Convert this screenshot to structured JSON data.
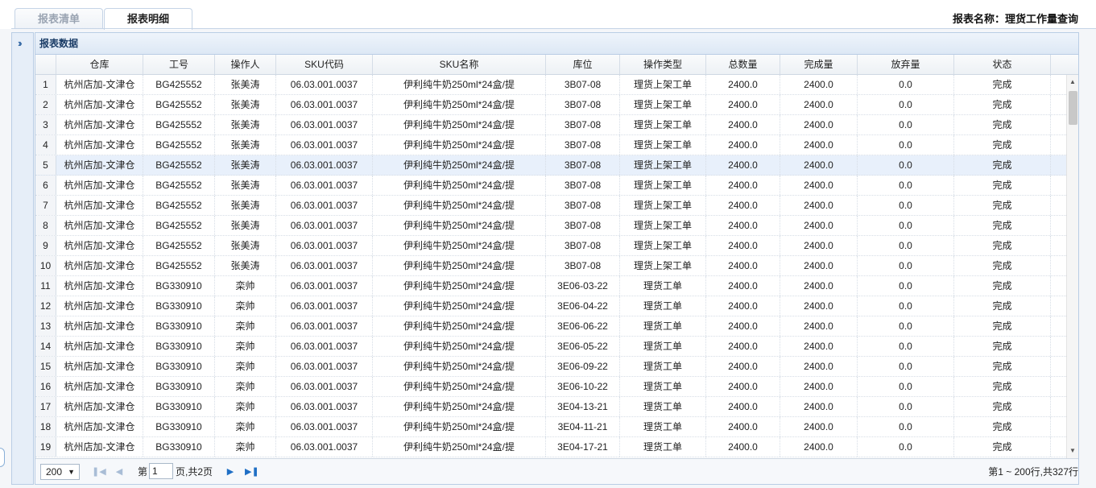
{
  "tabs": [
    {
      "label": "报表清单"
    },
    {
      "label": "报表明细"
    }
  ],
  "report_title": "报表名称：理货工作量查询",
  "panel": {
    "title": "报表数据"
  },
  "columns": [
    "",
    "仓库",
    "工号",
    "操作人",
    "SKU代码",
    "SKU名称",
    "库位",
    "操作类型",
    "总数量",
    "完成量",
    "放弃量",
    "状态"
  ],
  "rows": [
    [
      "1",
      "杭州店加-文津仓",
      "BG425552",
      "张美涛",
      "06.03.001.0037",
      "伊利纯牛奶250ml*24盒/提",
      "3B07-08",
      "理货上架工单",
      "2400.0",
      "2400.0",
      "0.0",
      "完成"
    ],
    [
      "2",
      "杭州店加-文津仓",
      "BG425552",
      "张美涛",
      "06.03.001.0037",
      "伊利纯牛奶250ml*24盒/提",
      "3B07-08",
      "理货上架工单",
      "2400.0",
      "2400.0",
      "0.0",
      "完成"
    ],
    [
      "3",
      "杭州店加-文津仓",
      "BG425552",
      "张美涛",
      "06.03.001.0037",
      "伊利纯牛奶250ml*24盒/提",
      "3B07-08",
      "理货上架工单",
      "2400.0",
      "2400.0",
      "0.0",
      "完成"
    ],
    [
      "4",
      "杭州店加-文津仓",
      "BG425552",
      "张美涛",
      "06.03.001.0037",
      "伊利纯牛奶250ml*24盒/提",
      "3B07-08",
      "理货上架工单",
      "2400.0",
      "2400.0",
      "0.0",
      "完成"
    ],
    [
      "5",
      "杭州店加-文津仓",
      "BG425552",
      "张美涛",
      "06.03.001.0037",
      "伊利纯牛奶250ml*24盒/提",
      "3B07-08",
      "理货上架工单",
      "2400.0",
      "2400.0",
      "0.0",
      "完成"
    ],
    [
      "6",
      "杭州店加-文津仓",
      "BG425552",
      "张美涛",
      "06.03.001.0037",
      "伊利纯牛奶250ml*24盒/提",
      "3B07-08",
      "理货上架工单",
      "2400.0",
      "2400.0",
      "0.0",
      "完成"
    ],
    [
      "7",
      "杭州店加-文津仓",
      "BG425552",
      "张美涛",
      "06.03.001.0037",
      "伊利纯牛奶250ml*24盒/提",
      "3B07-08",
      "理货上架工单",
      "2400.0",
      "2400.0",
      "0.0",
      "完成"
    ],
    [
      "8",
      "杭州店加-文津仓",
      "BG425552",
      "张美涛",
      "06.03.001.0037",
      "伊利纯牛奶250ml*24盒/提",
      "3B07-08",
      "理货上架工单",
      "2400.0",
      "2400.0",
      "0.0",
      "完成"
    ],
    [
      "9",
      "杭州店加-文津仓",
      "BG425552",
      "张美涛",
      "06.03.001.0037",
      "伊利纯牛奶250ml*24盒/提",
      "3B07-08",
      "理货上架工单",
      "2400.0",
      "2400.0",
      "0.0",
      "完成"
    ],
    [
      "10",
      "杭州店加-文津仓",
      "BG425552",
      "张美涛",
      "06.03.001.0037",
      "伊利纯牛奶250ml*24盒/提",
      "3B07-08",
      "理货上架工单",
      "2400.0",
      "2400.0",
      "0.0",
      "完成"
    ],
    [
      "11",
      "杭州店加-文津仓",
      "BG330910",
      "栾帅",
      "06.03.001.0037",
      "伊利纯牛奶250ml*24盒/提",
      "3E06-03-22",
      "理货工单",
      "2400.0",
      "2400.0",
      "0.0",
      "完成"
    ],
    [
      "12",
      "杭州店加-文津仓",
      "BG330910",
      "栾帅",
      "06.03.001.0037",
      "伊利纯牛奶250ml*24盒/提",
      "3E06-04-22",
      "理货工单",
      "2400.0",
      "2400.0",
      "0.0",
      "完成"
    ],
    [
      "13",
      "杭州店加-文津仓",
      "BG330910",
      "栾帅",
      "06.03.001.0037",
      "伊利纯牛奶250ml*24盒/提",
      "3E06-06-22",
      "理货工单",
      "2400.0",
      "2400.0",
      "0.0",
      "完成"
    ],
    [
      "14",
      "杭州店加-文津仓",
      "BG330910",
      "栾帅",
      "06.03.001.0037",
      "伊利纯牛奶250ml*24盒/提",
      "3E06-05-22",
      "理货工单",
      "2400.0",
      "2400.0",
      "0.0",
      "完成"
    ],
    [
      "15",
      "杭州店加-文津仓",
      "BG330910",
      "栾帅",
      "06.03.001.0037",
      "伊利纯牛奶250ml*24盒/提",
      "3E06-09-22",
      "理货工单",
      "2400.0",
      "2400.0",
      "0.0",
      "完成"
    ],
    [
      "16",
      "杭州店加-文津仓",
      "BG330910",
      "栾帅",
      "06.03.001.0037",
      "伊利纯牛奶250ml*24盒/提",
      "3E06-10-22",
      "理货工单",
      "2400.0",
      "2400.0",
      "0.0",
      "完成"
    ],
    [
      "17",
      "杭州店加-文津仓",
      "BG330910",
      "栾帅",
      "06.03.001.0037",
      "伊利纯牛奶250ml*24盒/提",
      "3E04-13-21",
      "理货工单",
      "2400.0",
      "2400.0",
      "0.0",
      "完成"
    ],
    [
      "18",
      "杭州店加-文津仓",
      "BG330910",
      "栾帅",
      "06.03.001.0037",
      "伊利纯牛奶250ml*24盒/提",
      "3E04-11-21",
      "理货工单",
      "2400.0",
      "2400.0",
      "0.0",
      "完成"
    ],
    [
      "19",
      "杭州店加-文津仓",
      "BG330910",
      "栾帅",
      "06.03.001.0037",
      "伊利纯牛奶250ml*24盒/提",
      "3E04-17-21",
      "理货工单",
      "2400.0",
      "2400.0",
      "0.0",
      "完成"
    ]
  ],
  "selected_row": 5,
  "pager": {
    "page_size": "200",
    "page_prefix": "第",
    "page_value": "1",
    "page_suffix": "页,共2页",
    "info": "第1 ~ 200行,共327行"
  },
  "icons": {
    "expand": "double-chevron-right-icon",
    "first": "first-page-icon",
    "prev": "prev-page-icon",
    "next": "next-page-icon",
    "last": "last-page-icon"
  },
  "colors": {
    "accent": "#1f6fc5",
    "header_text": "#1a3c66",
    "selected_row": "#e8f0fb"
  }
}
